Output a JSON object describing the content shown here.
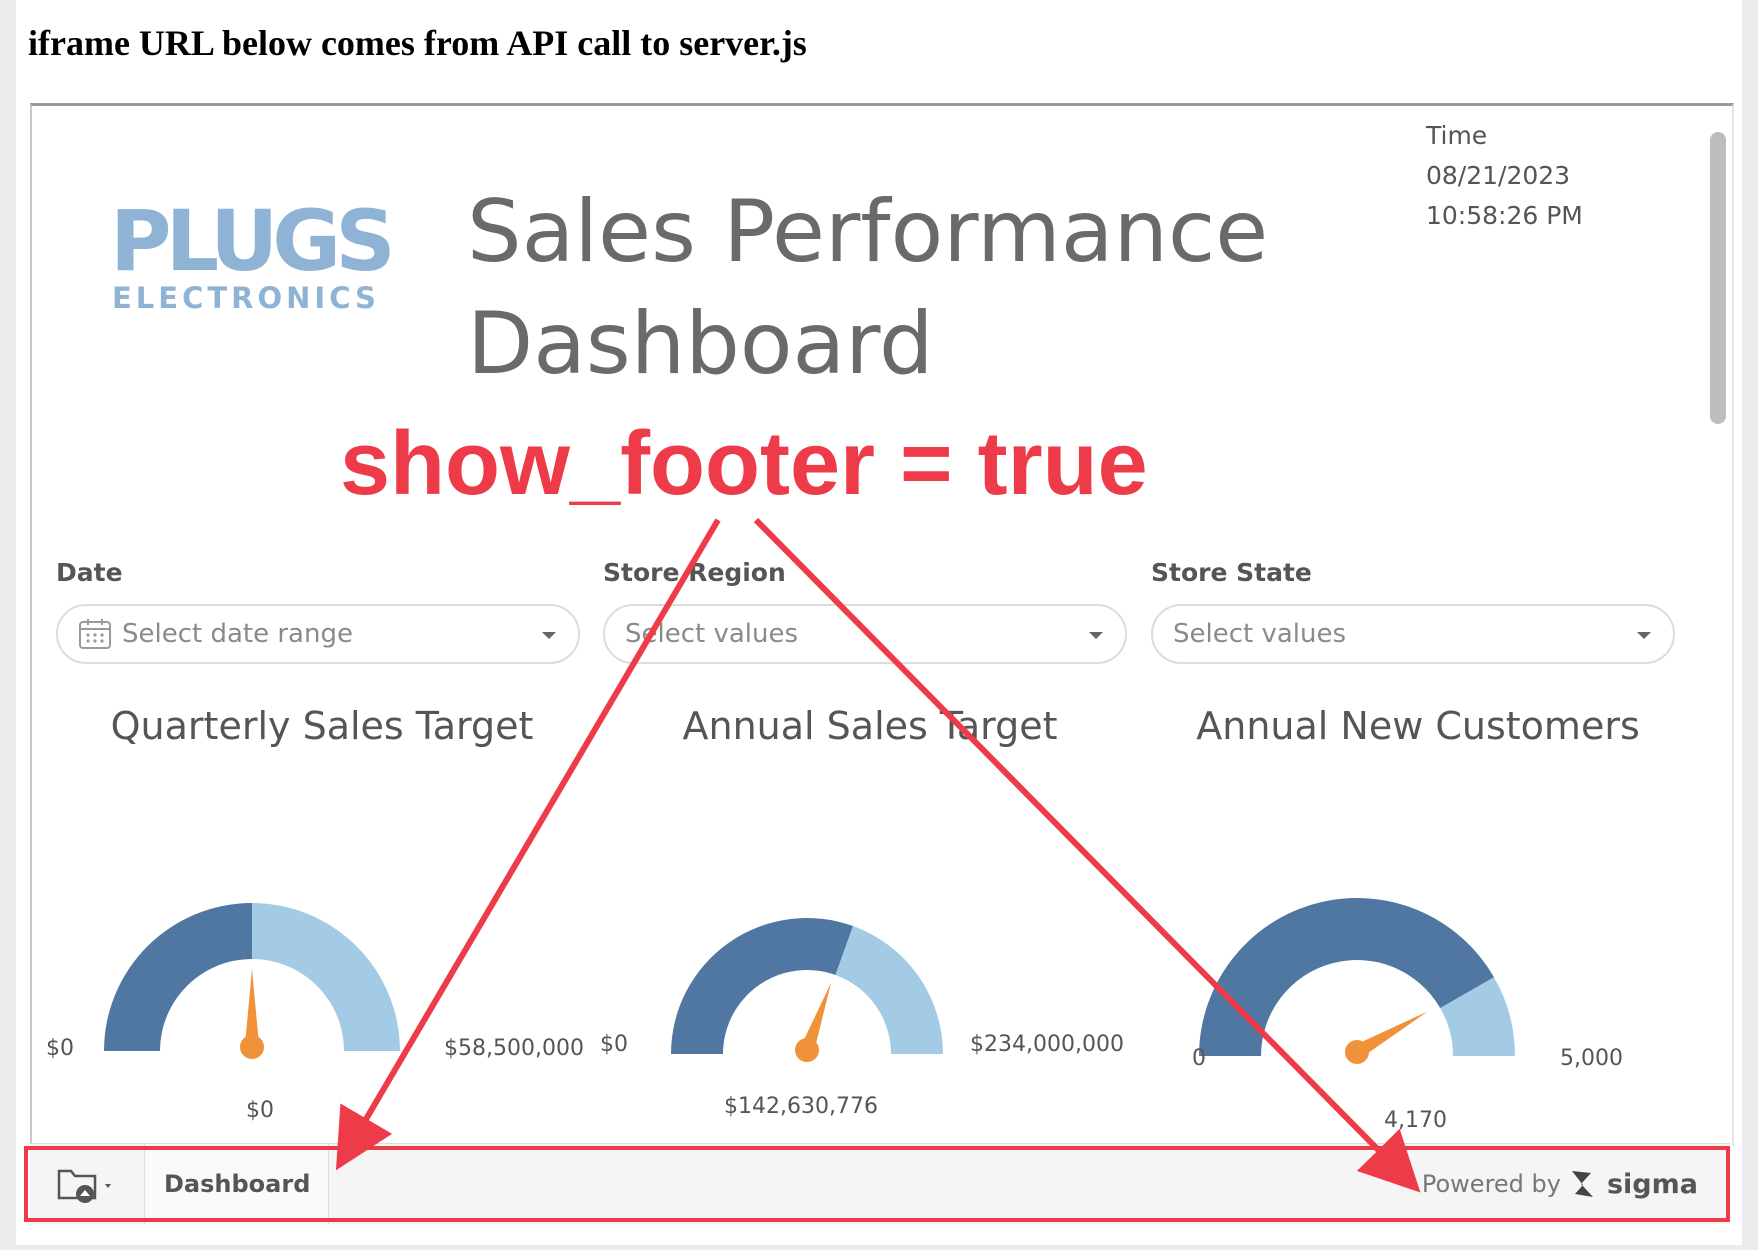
{
  "page": {
    "heading": "iframe URL below comes from API call to server.js"
  },
  "dashboard": {
    "logo": {
      "line1": "PLUGS",
      "line2": "ELECTRONICS"
    },
    "title_line1": "Sales Performance",
    "title_line2": "Dashboard",
    "time": {
      "label": "Time",
      "date": "08/21/2023",
      "clock": "10:58:26 PM"
    },
    "filters": [
      {
        "label": "Date",
        "placeholder": "Select date range",
        "icon": "calendar-icon"
      },
      {
        "label": "Store Region",
        "placeholder": "Select values"
      },
      {
        "label": "Store State",
        "placeholder": "Select values"
      }
    ],
    "gauges": [
      {
        "title": "Quarterly Sales Target",
        "min_label": "$0",
        "max_label": "$58,500,000",
        "value_label": "$0",
        "value": 0,
        "min": 0,
        "max": 58500000,
        "progress_fraction": 0.5
      },
      {
        "title": "Annual Sales Target",
        "min_label": "$0",
        "max_label": "$234,000,000",
        "value_label": "$142,630,776",
        "value": 142630776,
        "min": 0,
        "max": 234000000,
        "progress_fraction": 0.61
      },
      {
        "title": "Annual New Customers",
        "min_label": "0",
        "max_label": "5,000",
        "value_label": "4,170",
        "value": 4170,
        "min": 0,
        "max": 5000,
        "progress_fraction": 0.834
      }
    ],
    "colors": {
      "dark_blue": "#4f77a2",
      "light_blue": "#a4cbe5",
      "needle": "#f0923a",
      "annotation_red": "#ee3b49"
    }
  },
  "footer": {
    "folder_icon": "folder-icon",
    "tab_label": "Dashboard",
    "powered_by": "Powered by",
    "brand": "sigma"
  },
  "annotation": {
    "text": "show_footer = true"
  }
}
